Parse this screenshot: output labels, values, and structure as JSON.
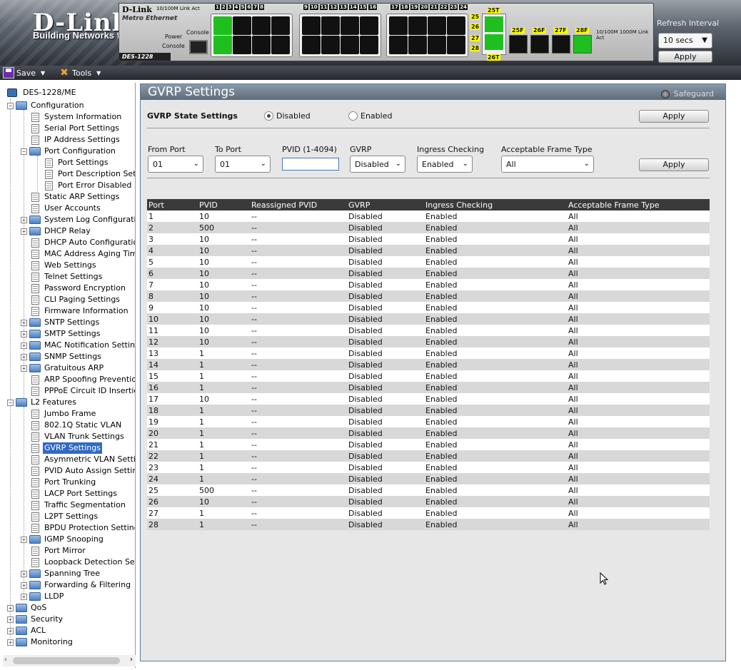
{
  "header": {
    "brand": "D-Link",
    "brand_sub": "Building Networks for People",
    "device": {
      "logo": "D-Link",
      "legend": "10/100M  Link  Act",
      "metro": "Metro Ethernet",
      "model": "DES-1228",
      "power_label": "Power",
      "console_label": "Console",
      "console_port_label": "Console",
      "group1_nums": [
        "1",
        "2",
        "3",
        "4",
        "5",
        "6",
        "7",
        "8"
      ],
      "group2_nums": [
        "9",
        "10",
        "11",
        "12",
        "13",
        "14",
        "15",
        "16"
      ],
      "group3_nums": [
        "17",
        "18",
        "19",
        "20",
        "21",
        "22",
        "23",
        "24"
      ],
      "combo_top": "25T",
      "combo_bottom": "26T",
      "combo_nums": [
        "25",
        "26",
        "27",
        "28"
      ],
      "sfp_labels": [
        "25F",
        "26F",
        "27F",
        "28F"
      ],
      "legend2": "10/100M 1000M  Link  Act"
    },
    "refresh_label": "Refresh Interval",
    "refresh_value": "10 secs",
    "refresh_apply": "Apply"
  },
  "toolbar": {
    "save": "Save",
    "tools": "Tools"
  },
  "sidebar": {
    "root": "DES-1228/ME",
    "items": [
      {
        "label": "Configuration"
      },
      {
        "label": "System Information"
      },
      {
        "label": "Serial Port Settings"
      },
      {
        "label": "IP Address Settings"
      },
      {
        "label": "Port Configuration"
      },
      {
        "label": "Port Settings"
      },
      {
        "label": "Port Description Settings"
      },
      {
        "label": "Port Error Disabled"
      },
      {
        "label": "Static ARP Settings"
      },
      {
        "label": "User Accounts"
      },
      {
        "label": "System Log Configuration"
      },
      {
        "label": "DHCP Relay"
      },
      {
        "label": "DHCP Auto Configuration"
      },
      {
        "label": "MAC Address Aging Time"
      },
      {
        "label": "Web Settings"
      },
      {
        "label": "Telnet Settings"
      },
      {
        "label": "Password Encryption"
      },
      {
        "label": "CLI Paging Settings"
      },
      {
        "label": "Firmware Information"
      },
      {
        "label": "SNTP Settings"
      },
      {
        "label": "SMTP Settings"
      },
      {
        "label": "MAC Notification Settings"
      },
      {
        "label": "SNMP Settings"
      },
      {
        "label": "Gratuitous ARP"
      },
      {
        "label": "ARP Spoofing Prevention"
      },
      {
        "label": "PPPoE Circuit ID Insertion"
      },
      {
        "label": "L2 Features"
      },
      {
        "label": "Jumbo Frame"
      },
      {
        "label": "802.1Q Static VLAN"
      },
      {
        "label": "VLAN Trunk Settings"
      },
      {
        "label": "GVRP Settings"
      },
      {
        "label": "Asymmetric VLAN Settings"
      },
      {
        "label": "PVID Auto Assign Settings"
      },
      {
        "label": "Port Trunking"
      },
      {
        "label": "LACP Port Settings"
      },
      {
        "label": "Traffic Segmentation"
      },
      {
        "label": "L2PT Settings"
      },
      {
        "label": "BPDU Protection Settings"
      },
      {
        "label": "IGMP Snooping"
      },
      {
        "label": "Port Mirror"
      },
      {
        "label": "Loopback Detection Settings"
      },
      {
        "label": "Spanning Tree"
      },
      {
        "label": "Forwarding & Filtering"
      },
      {
        "label": "LLDP"
      },
      {
        "label": "QoS"
      },
      {
        "label": "Security"
      },
      {
        "label": "ACL"
      },
      {
        "label": "Monitoring"
      }
    ]
  },
  "main": {
    "title": "GVRP Settings",
    "safeguard": "Safeguard",
    "state_label": "GVRP State Settings",
    "state_disabled": "Disabled",
    "state_enabled": "Enabled",
    "state_selected": "Disabled",
    "apply": "Apply",
    "form": {
      "from_port_label": "From Port",
      "from_port_value": "01",
      "to_port_label": "To Port",
      "to_port_value": "01",
      "pvid_label": "PVID (1-4094)",
      "pvid_value": "",
      "gvrp_label": "GVRP",
      "gvrp_value": "Disabled",
      "ingress_label": "Ingress Checking",
      "ingress_value": "Enabled",
      "frame_label": "Acceptable Frame Type",
      "frame_value": "All",
      "apply": "Apply"
    },
    "table": {
      "headers": [
        "Port",
        "PVID",
        "Reassigned PVID",
        "GVRP",
        "Ingress Checking",
        "Acceptable Frame Type"
      ],
      "rows": [
        [
          "1",
          "10",
          "--",
          "Disabled",
          "Enabled",
          "All"
        ],
        [
          "2",
          "500",
          "--",
          "Disabled",
          "Enabled",
          "All"
        ],
        [
          "3",
          "10",
          "--",
          "Disabled",
          "Enabled",
          "All"
        ],
        [
          "4",
          "10",
          "--",
          "Disabled",
          "Enabled",
          "All"
        ],
        [
          "5",
          "10",
          "--",
          "Disabled",
          "Enabled",
          "All"
        ],
        [
          "6",
          "10",
          "--",
          "Disabled",
          "Enabled",
          "All"
        ],
        [
          "7",
          "10",
          "--",
          "Disabled",
          "Enabled",
          "All"
        ],
        [
          "8",
          "10",
          "--",
          "Disabled",
          "Enabled",
          "All"
        ],
        [
          "9",
          "10",
          "--",
          "Disabled",
          "Enabled",
          "All"
        ],
        [
          "10",
          "10",
          "--",
          "Disabled",
          "Enabled",
          "All"
        ],
        [
          "11",
          "10",
          "--",
          "Disabled",
          "Enabled",
          "All"
        ],
        [
          "12",
          "10",
          "--",
          "Disabled",
          "Enabled",
          "All"
        ],
        [
          "13",
          "1",
          "--",
          "Disabled",
          "Enabled",
          "All"
        ],
        [
          "14",
          "1",
          "--",
          "Disabled",
          "Enabled",
          "All"
        ],
        [
          "15",
          "1",
          "--",
          "Disabled",
          "Enabled",
          "All"
        ],
        [
          "16",
          "1",
          "--",
          "Disabled",
          "Enabled",
          "All"
        ],
        [
          "17",
          "10",
          "--",
          "Disabled",
          "Enabled",
          "All"
        ],
        [
          "18",
          "1",
          "--",
          "Disabled",
          "Enabled",
          "All"
        ],
        [
          "19",
          "1",
          "--",
          "Disabled",
          "Enabled",
          "All"
        ],
        [
          "20",
          "1",
          "--",
          "Disabled",
          "Enabled",
          "All"
        ],
        [
          "21",
          "1",
          "--",
          "Disabled",
          "Enabled",
          "All"
        ],
        [
          "22",
          "1",
          "--",
          "Disabled",
          "Enabled",
          "All"
        ],
        [
          "23",
          "1",
          "--",
          "Disabled",
          "Enabled",
          "All"
        ],
        [
          "24",
          "1",
          "--",
          "Disabled",
          "Enabled",
          "All"
        ],
        [
          "25",
          "500",
          "--",
          "Disabled",
          "Enabled",
          "All"
        ],
        [
          "26",
          "10",
          "--",
          "Disabled",
          "Enabled",
          "All"
        ],
        [
          "27",
          "1",
          "--",
          "Disabled",
          "Enabled",
          "All"
        ],
        [
          "28",
          "1",
          "--",
          "Disabled",
          "Enabled",
          "All"
        ]
      ]
    }
  }
}
